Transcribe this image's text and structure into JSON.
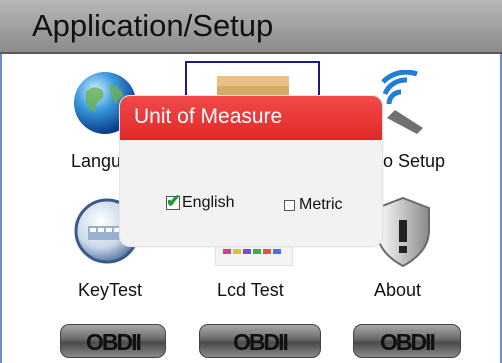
{
  "header": {
    "title": "Application/Setup"
  },
  "menu_items": [
    {
      "label": "Langu",
      "icon": "globe-icon"
    },
    {
      "label": "",
      "icon": "ruler-icon",
      "selected": true
    },
    {
      "label": "o Setup",
      "icon": "wireless-icon"
    },
    {
      "label": "KeyTest",
      "icon": "keyboard-icon"
    },
    {
      "label": "Lcd Test",
      "icon": "lcd-icon"
    },
    {
      "label": "About",
      "icon": "info-shield-icon"
    }
  ],
  "dialog": {
    "title": "Unit of Measure",
    "options": [
      {
        "label": "English",
        "checked": true
      },
      {
        "label": "Metric",
        "checked": false
      }
    ]
  },
  "footer": {
    "buttons": [
      "OBDII",
      "OBDII",
      "OBDII"
    ]
  },
  "colors": {
    "dialog_header": "#e53535",
    "selection_border": "#1b1b8a",
    "title_bar": "#9c9c9c"
  }
}
